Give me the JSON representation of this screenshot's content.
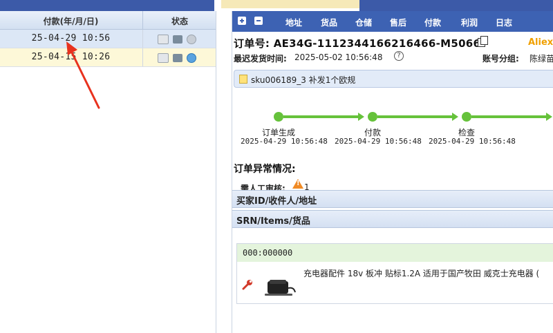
{
  "left_table": {
    "headers": [
      "付款(年/月/日)",
      "状态"
    ],
    "rows": [
      {
        "date": "25-04-29 10:56",
        "selected": true
      },
      {
        "date": "25-04-15 10:26",
        "selected": false
      }
    ]
  },
  "toolbar": {
    "items": [
      "地址",
      "货品",
      "仓储",
      "售后",
      "付款",
      "利润",
      "日志"
    ]
  },
  "order": {
    "number": "订单号:  AE34G-1112344166216466-M5066",
    "platform": "Aliexp",
    "latest_ship_label": "最迟发货时间:",
    "latest_ship_value": "2025-05-02 10:56:48",
    "account_group_label": "账号分组:",
    "account_group_value": "陈绿苗"
  },
  "note": {
    "text": "sku006189_3 补发1个欧规"
  },
  "progress": {
    "steps": [
      {
        "label": "订单生成",
        "date": "2025-04-29 10:56:48"
      },
      {
        "label": "付款",
        "date": "2025-04-29 10:56:48"
      },
      {
        "label": "检查",
        "date": "2025-04-29 10:56:48"
      }
    ]
  },
  "exception": {
    "title": "订单异常情况:",
    "review_label": "需人工审核:",
    "review_count": "1"
  },
  "sections": {
    "buyer": "买家ID/收件人/地址",
    "items": "SRN/Items/货品"
  },
  "item": {
    "srn": "000:000000",
    "title": "充电器配件 18v 板冲 贴标1.2A 适用于国产牧田 威克士充电器 (",
    "thumb_icon": "charger-image",
    "wrench_icon": "wrench-icon"
  },
  "colors": {
    "header_blue": "#3d62b3",
    "selected_row": "#dce7f6",
    "alt_row": "#fdf8d8",
    "progress_green": "#66c23b",
    "annotation_arrow": "#e8321e"
  }
}
